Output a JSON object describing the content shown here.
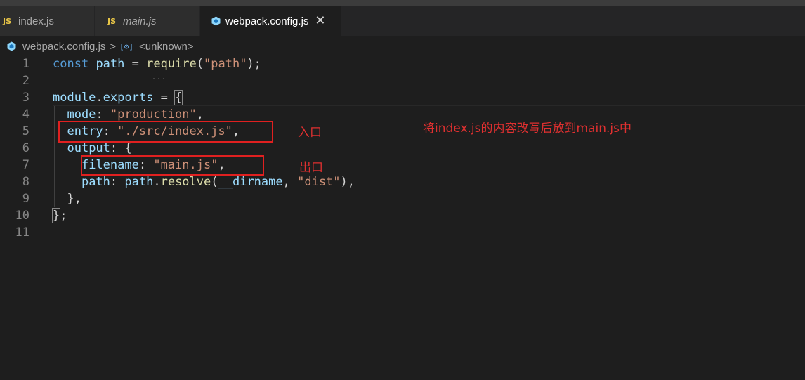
{
  "tabs": [
    {
      "icon": "JS",
      "label": "index.js"
    },
    {
      "icon": "JS",
      "label": "main.js"
    },
    {
      "label": "webpack.config.js",
      "close": "✕"
    }
  ],
  "breadcrumb": {
    "file": "webpack.config.js",
    "separator": ">",
    "symbol_icon": "[⊘]",
    "symbol": "<unknown>"
  },
  "code": {
    "line_numbers": [
      "1",
      "2",
      "3",
      "4",
      "5",
      "6",
      "7",
      "8",
      "9",
      "10",
      "11"
    ],
    "line1": {
      "kw": "const",
      "var": "path",
      "eq": " = ",
      "fn": "require",
      "open": "(",
      "str": "\"path\"",
      "close": ");"
    },
    "line3": {
      "kw": "module",
      "dot": ".",
      "var": "exports",
      "eq": " = ",
      "brace": "{"
    },
    "line4": {
      "key": "mode",
      "colon": ": ",
      "str": "\"production\"",
      "comma": ","
    },
    "line5": {
      "key": "entry",
      "colon": ": ",
      "str": "\"./src/index.js\"",
      "comma": ","
    },
    "line6": {
      "key": "output",
      "colon": ": ",
      "brace": "{"
    },
    "line7": {
      "key": "filename",
      "colon": ": ",
      "str": "\"main.js\"",
      "comma": ","
    },
    "line8": {
      "key": "path",
      "colon": ": ",
      "obj": "path",
      "dot": ".",
      "fn": "resolve",
      "open": "(",
      "arg": "__dirname",
      "sep": ", ",
      "str": "\"dist\"",
      "close": "),"
    },
    "line9": {
      "text": "},"
    },
    "line10": {
      "brace": "}",
      "semi": ";"
    }
  },
  "annotations": {
    "entry_label": "入口",
    "output_label": "出口",
    "note": "将index.js的内容改写后放到main.js中"
  },
  "colors": {
    "annotation_red": "#e02020",
    "keyword": "#569cd6",
    "variable": "#9cdcfe",
    "function": "#dcdcaa",
    "string": "#ce9178"
  }
}
